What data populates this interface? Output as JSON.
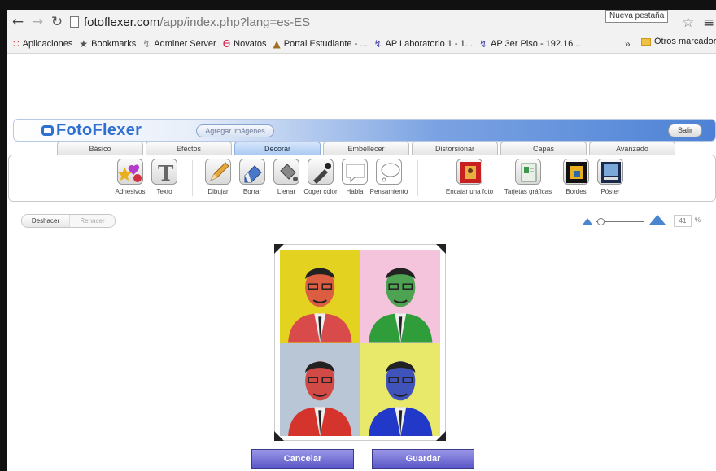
{
  "browser": {
    "url_host": "fotoflexer.com",
    "url_path": "/app/index.php?lang=es-ES",
    "new_tab_tooltip": "Nueva pestaña",
    "bookmarks": [
      {
        "label": "Aplicaciones",
        "icon": "apps-grid-icon"
      },
      {
        "label": "Bookmarks",
        "icon": "star-icon"
      },
      {
        "label": "Adminer Server",
        "icon": "adminer-icon"
      },
      {
        "label": "Novatos",
        "icon": "debian-icon"
      },
      {
        "label": "Portal Estudiante - ...",
        "icon": "portal-icon"
      },
      {
        "label": "AP Laboratorio 1 - 1...",
        "icon": "wifi-icon"
      },
      {
        "label": "AP 3er Piso - 192.16...",
        "icon": "wifi-icon"
      }
    ],
    "more_label": "»",
    "other_bookmarks": "Otros marcadores"
  },
  "app": {
    "logo": "FotoFlexer",
    "add_images": "Agregar imágenes",
    "exit": "Salir",
    "tabs": [
      "Básico",
      "Efectos",
      "Decorar",
      "Embellecer",
      "Distorsionar",
      "Capas",
      "Avanzado"
    ],
    "active_tab": "Decorar",
    "tools": [
      {
        "label": "Adhesivos",
        "icon": "stickers-icon"
      },
      {
        "label": "Texto",
        "icon": "text-icon"
      },
      {
        "label": "Dibujar",
        "icon": "pencil-icon"
      },
      {
        "label": "Borrar",
        "icon": "eraser-icon"
      },
      {
        "label": "Llenar",
        "icon": "fill-bucket-icon"
      },
      {
        "label": "Coger color",
        "icon": "eyedropper-icon"
      },
      {
        "label": "Habla",
        "icon": "speech-bubble-icon"
      },
      {
        "label": "Pensamiento",
        "icon": "thought-bubble-icon"
      },
      {
        "label": "Encajar una foto",
        "icon": "photo-frame-icon"
      },
      {
        "label": "Tarjetas gráficas",
        "icon": "greeting-card-icon"
      },
      {
        "label": "Bordes",
        "icon": "borders-icon"
      },
      {
        "label": "Póster",
        "icon": "poster-icon"
      }
    ],
    "undo": "Deshacer",
    "redo": "Rehacer",
    "zoom_value": "41",
    "zoom_unit": "%",
    "cancel": "Cancelar",
    "save": "Guardar",
    "panel_colors": [
      {
        "bg": "#e3d21f",
        "accent": "#d94a4a"
      },
      {
        "bg": "#f4c3dc",
        "accent": "#2f9e3a"
      },
      {
        "bg": "#b9c6d6",
        "accent": "#d5342c"
      },
      {
        "bg": "#e8e86a",
        "accent": "#2238c8"
      }
    ]
  }
}
